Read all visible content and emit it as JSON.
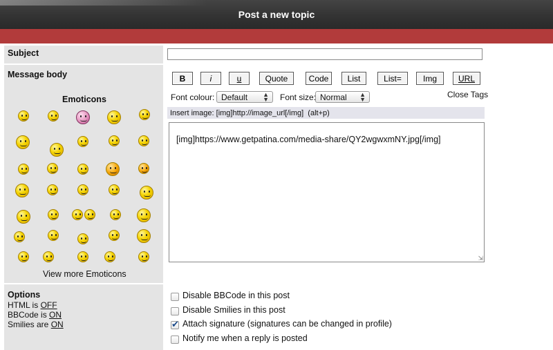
{
  "header": {
    "title": "Post a new topic"
  },
  "subject": {
    "label": "Subject",
    "value": ""
  },
  "message": {
    "label": "Message body",
    "emoticons_heading": "Emoticons",
    "view_more": "View more Emoticons",
    "toolbar": {
      "bold": "B",
      "italic": "i",
      "underline": "u",
      "quote": "Quote",
      "code": "Code",
      "list": "List",
      "list_eq": "List=",
      "img": "Img",
      "url": "URL"
    },
    "font_colour_label": "Font colour:",
    "font_colour_value": "Default",
    "font_size_label": "Font size:",
    "font_size_value": "Normal",
    "close_tags": "Close Tags",
    "hint": "Insert image: [img]http://image_url[/img]  (alt+p)",
    "body": "[img]https://www.getpatina.com/media-share/QY2wgwxmNY.jpg[/img]"
  },
  "options": {
    "heading": "Options",
    "html_label": "HTML is",
    "html_state": "OFF",
    "bbcode_label": "BBCode is",
    "bbcode_state": "ON",
    "smilies_label": "Smilies are",
    "smilies_state": "ON",
    "checkboxes": [
      {
        "label": "Disable BBCode in this post",
        "checked": false
      },
      {
        "label": "Disable Smilies in this post",
        "checked": false
      },
      {
        "label": "Attach signature (signatures can be changed in profile)",
        "checked": true
      },
      {
        "label": "Notify me when a reply is posted",
        "checked": false
      }
    ]
  },
  "colors": {
    "header_bg": "#333333",
    "accent_red": "#b23b3b",
    "cell_gray": "#e4e4e4"
  },
  "icons": [
    "smiley-icon"
  ]
}
